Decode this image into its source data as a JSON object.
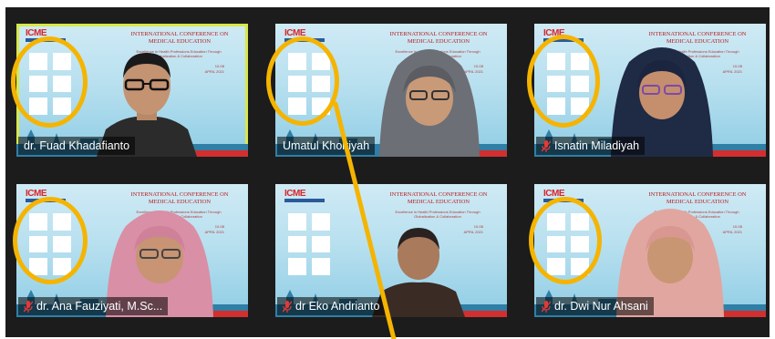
{
  "slide": {
    "brand": "ICME",
    "title": "International Conference on Medical Education",
    "subtitle": "Excellence in Health Professions Education Through Globalization & Collaboration",
    "date_line1": "10-08",
    "date_line2": "APRIL 2021"
  },
  "participants": [
    {
      "name": "dr. Fuad Khadafianto",
      "muted": false,
      "active": true
    },
    {
      "name": "Umatul Khoiriyah",
      "muted": false,
      "active": false
    },
    {
      "name": "Isnatin Miladiyah",
      "muted": true,
      "active": false
    },
    {
      "name": "dr. Ana Fauziyati, M.Sc...",
      "muted": true,
      "active": false
    },
    {
      "name": "dr Eko Andrianto",
      "muted": true,
      "active": false
    },
    {
      "name": "dr. Dwi Nur Ahsani",
      "muted": true,
      "active": false
    }
  ],
  "annotation": {
    "highlight_color": "#f5b400",
    "highlight_shape": "ellipse",
    "arrow_color": "#f5b400"
  },
  "colors": {
    "stage_background": "#1c1c1c",
    "active_speaker_border": "#d7e84a",
    "mic_muted": "#e53935"
  }
}
